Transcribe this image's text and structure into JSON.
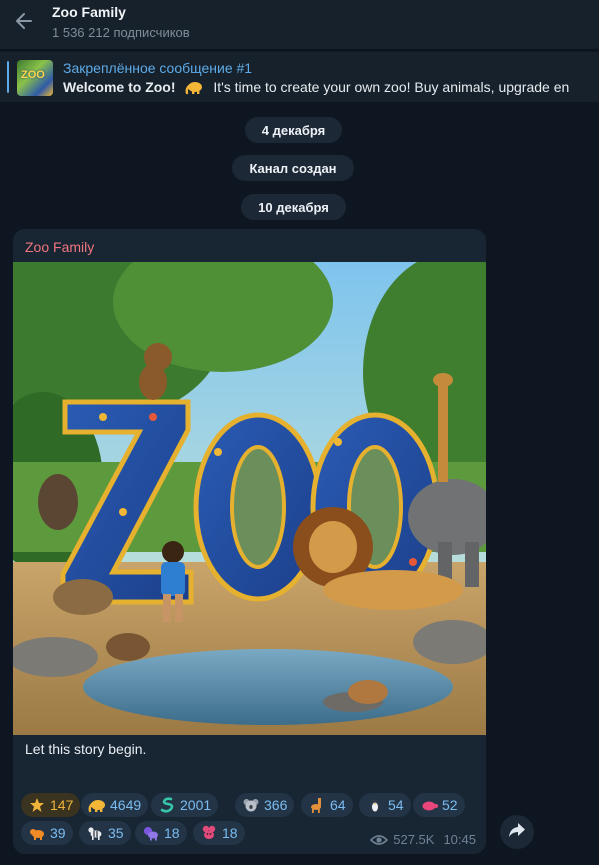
{
  "header": {
    "title": "Zoo Family",
    "subtitle": "1 536 212 подписчиков"
  },
  "pinned": {
    "title": "Закреплённое сообщение #1",
    "bold": "Welcome to Zoo!",
    "text": "It's time to create your own zoo!  Buy animals, upgrade en",
    "thumb_label": "ZOO"
  },
  "dates": [
    "4 декабря",
    "Канал создан",
    "10 декабря"
  ],
  "message": {
    "author": "Zoo Family",
    "photo_text": "ZOO",
    "caption": "Let this story begin.",
    "views": "527.5K",
    "time": "10:45"
  },
  "reactions": [
    {
      "icon": "star-icon",
      "count": "147"
    },
    {
      "icon": "elephant-icon",
      "count": "4649"
    },
    {
      "icon": "snake-icon",
      "count": "2001"
    },
    {
      "icon": "koala-icon",
      "count": "366"
    },
    {
      "icon": "giraffe-icon",
      "count": "64"
    },
    {
      "icon": "penguin-icon",
      "count": "54"
    },
    {
      "icon": "turtle-icon",
      "count": "52"
    },
    {
      "icon": "tiger-icon",
      "count": "39"
    },
    {
      "icon": "zebra-icon",
      "count": "35"
    },
    {
      "icon": "lion-icon",
      "count": "18"
    },
    {
      "icon": "flamingo-icon",
      "count": "18"
    }
  ],
  "colors": {
    "background": "#0e1621",
    "panel": "#17212b",
    "accent": "#5eabe8",
    "author": "#f2757e",
    "reaction_text": "#7bbcf0",
    "star": "#f0b43c"
  }
}
